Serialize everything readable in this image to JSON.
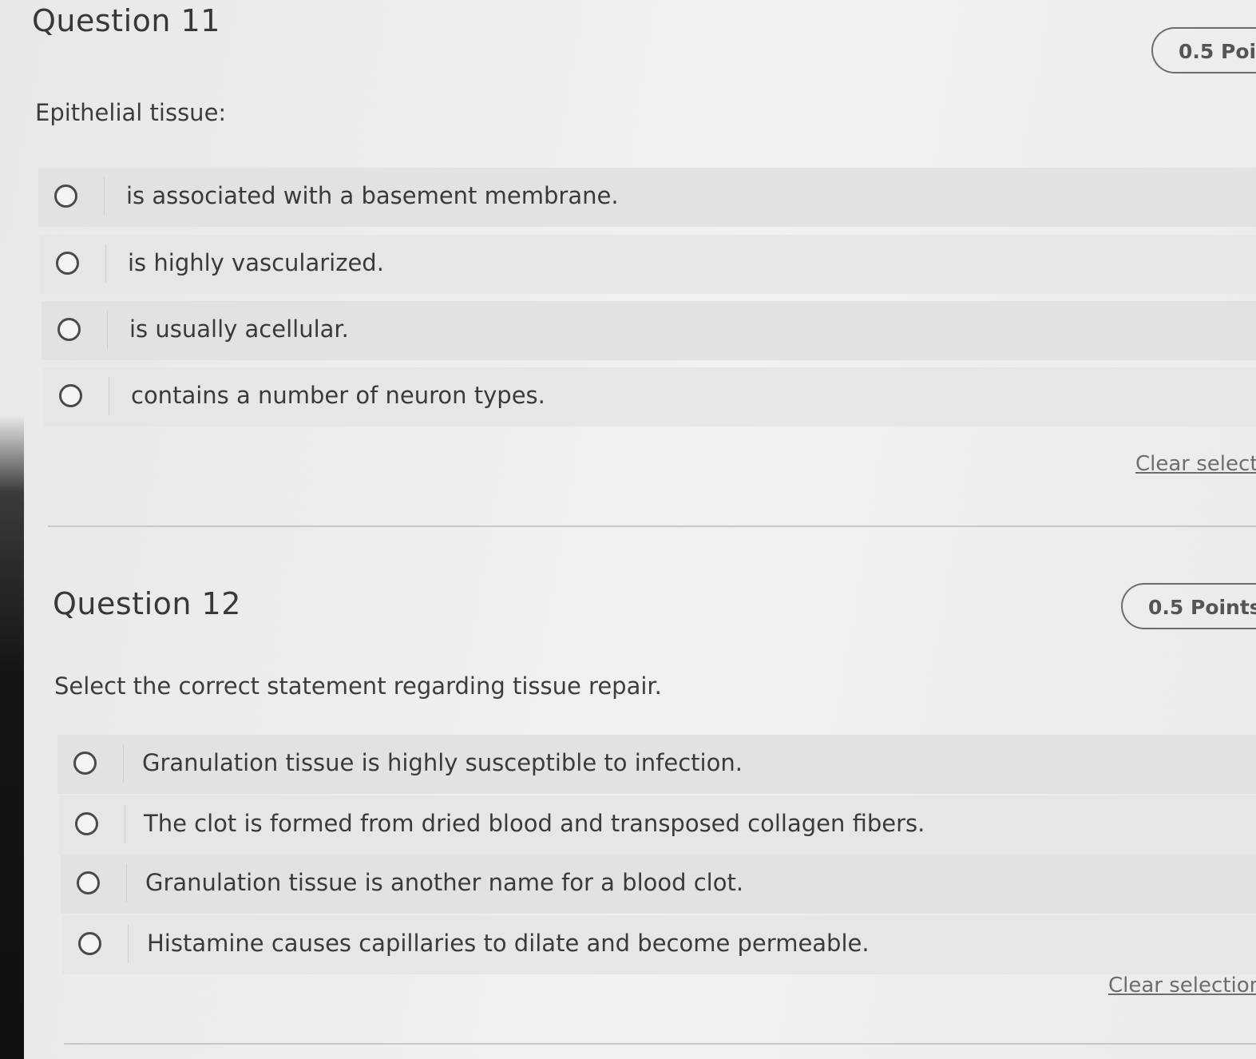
{
  "questions": [
    {
      "title": "Question 11",
      "points": "0.5 Poi",
      "prompt": "Epithelial tissue:",
      "options": [
        "is associated with a basement membrane.",
        "is highly vascularized.",
        "is usually acellular.",
        "contains a number of neuron types."
      ],
      "clear_label": "Clear select"
    },
    {
      "title": "Question 12",
      "points": "0.5 Points",
      "prompt": "Select the correct statement regarding tissue repair.",
      "options": [
        "Granulation tissue is highly susceptible to infection.",
        "The clot is formed from dried blood and transposed collagen fibers.",
        "Granulation tissue is another name for a blood clot.",
        "Histamine causes capillaries to dilate and become permeable."
      ],
      "clear_label": "Clear selection"
    }
  ]
}
